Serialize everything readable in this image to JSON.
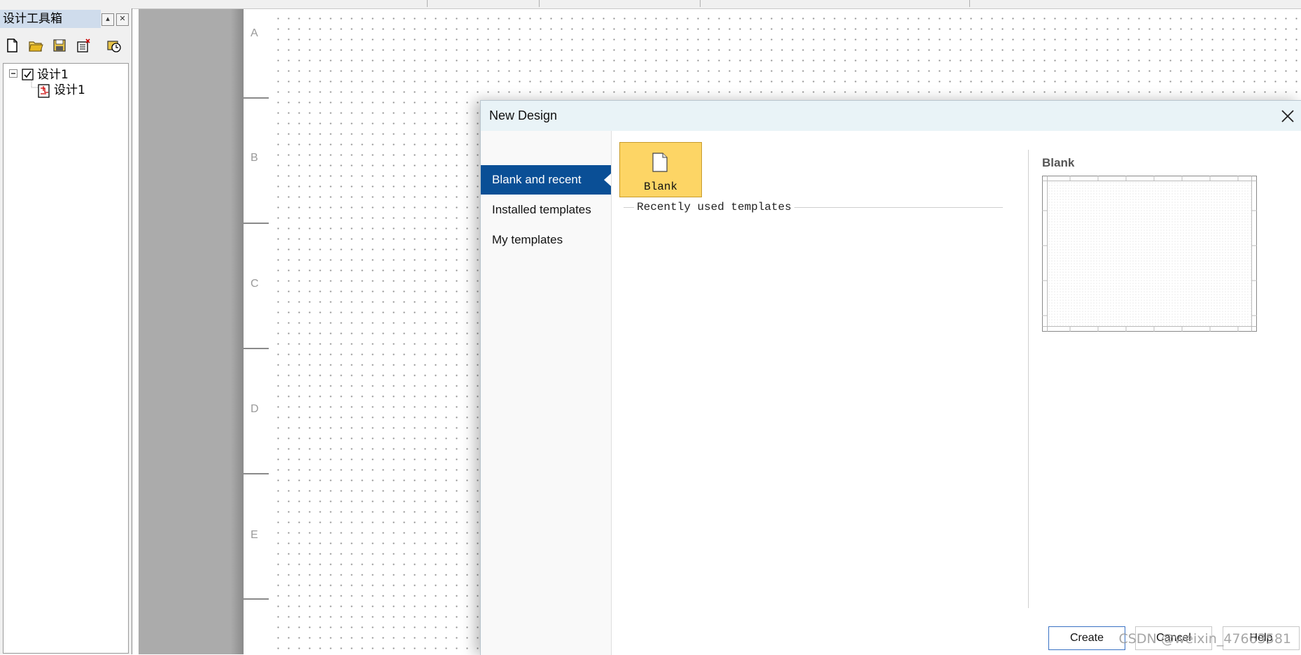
{
  "toolbox": {
    "title": "设计工具箱",
    "pin_label": "▴",
    "close_label": "✕",
    "tree": [
      {
        "label": "设计1"
      },
      {
        "label": "设计1"
      }
    ]
  },
  "ruler": {
    "labels": [
      "A",
      "B",
      "C",
      "D",
      "E"
    ]
  },
  "dialog": {
    "title": "New Design",
    "nav": [
      {
        "label": "Blank and recent"
      },
      {
        "label": "Installed templates"
      },
      {
        "label": "My templates"
      }
    ],
    "tile_label": "Blank",
    "recent_label": "Recently used templates",
    "preview_title": "Blank",
    "buttons": {
      "create": "Create",
      "cancel": "Cancel",
      "help": "Help"
    }
  },
  "watermark": "CSDN @weixin_47663581",
  "colors": {
    "accent": "#0a4f96",
    "tile": "#fdd565",
    "titlebar": "#e9f3f7"
  }
}
